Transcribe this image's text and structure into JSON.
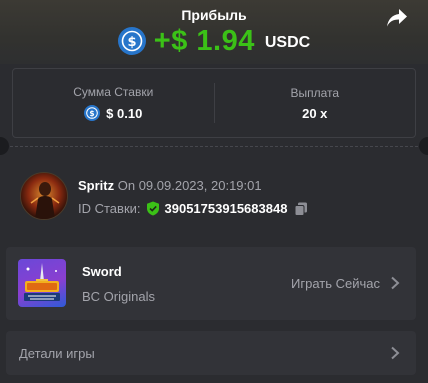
{
  "header": {
    "title": "Прибыль",
    "amount": "+$ 1.94",
    "currency": "USDC"
  },
  "stats": {
    "bet_label": "Сумма Ставки",
    "bet_value": "$ 0.10",
    "payout_label": "Выплата",
    "payout_value": "20 x"
  },
  "user": {
    "name": "Spritz",
    "date": "On 09.09.2023, 20:19:01",
    "bet_id_label": "ID Ставки:",
    "bet_id": "39051753915683848"
  },
  "game": {
    "name": "Sword",
    "provider": "BC Originals",
    "play_label": "Играть Сейчас"
  },
  "details": {
    "label": "Детали игры"
  },
  "colors": {
    "profit": "#3bc117",
    "usdc": "#2775ca",
    "background": "#2b2c30",
    "card": "#323338",
    "muted_text": "#a3a4ab"
  }
}
